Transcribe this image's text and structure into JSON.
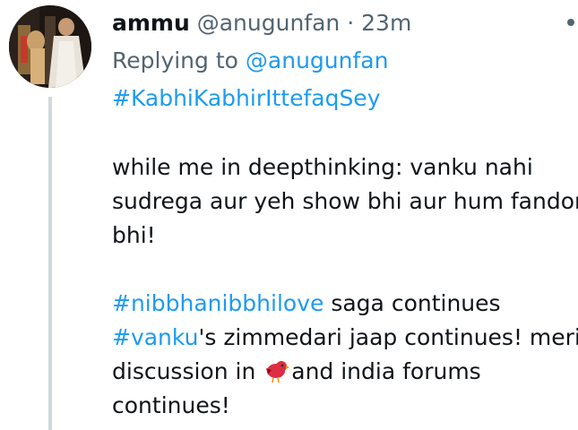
{
  "tweet": {
    "display_name": "ammu",
    "handle": "@anugunfan",
    "separator": "·",
    "time": "23m",
    "replying_prefix": "Replying to",
    "replying_to": "@anugunfan",
    "top_hashtag": "#KabhiKabhirIttefaqSey",
    "lines": {
      "l1": "while me in deepthinking: vanku nahi",
      "l2": "sudrega aur yeh show bhi aur hum fandom",
      "l3": "bhi!",
      "l4_tag": "#nibbhanibbhilove",
      "l4_rest": " saga continues",
      "l5_tag": "#vanku",
      "l5_rest": "'s zimmedari jaap continues! meri",
      "l6_pre": "discussion in ",
      "l6_post": "and india forums",
      "l7": "continues!"
    }
  },
  "colors": {
    "link": "#1d9bf0",
    "muted": "#536471",
    "text": "#0f1419",
    "thread_line": "#cfd9de"
  },
  "icons": {
    "more": "more-dot-icon",
    "emoji": "red-bird-emoji"
  }
}
